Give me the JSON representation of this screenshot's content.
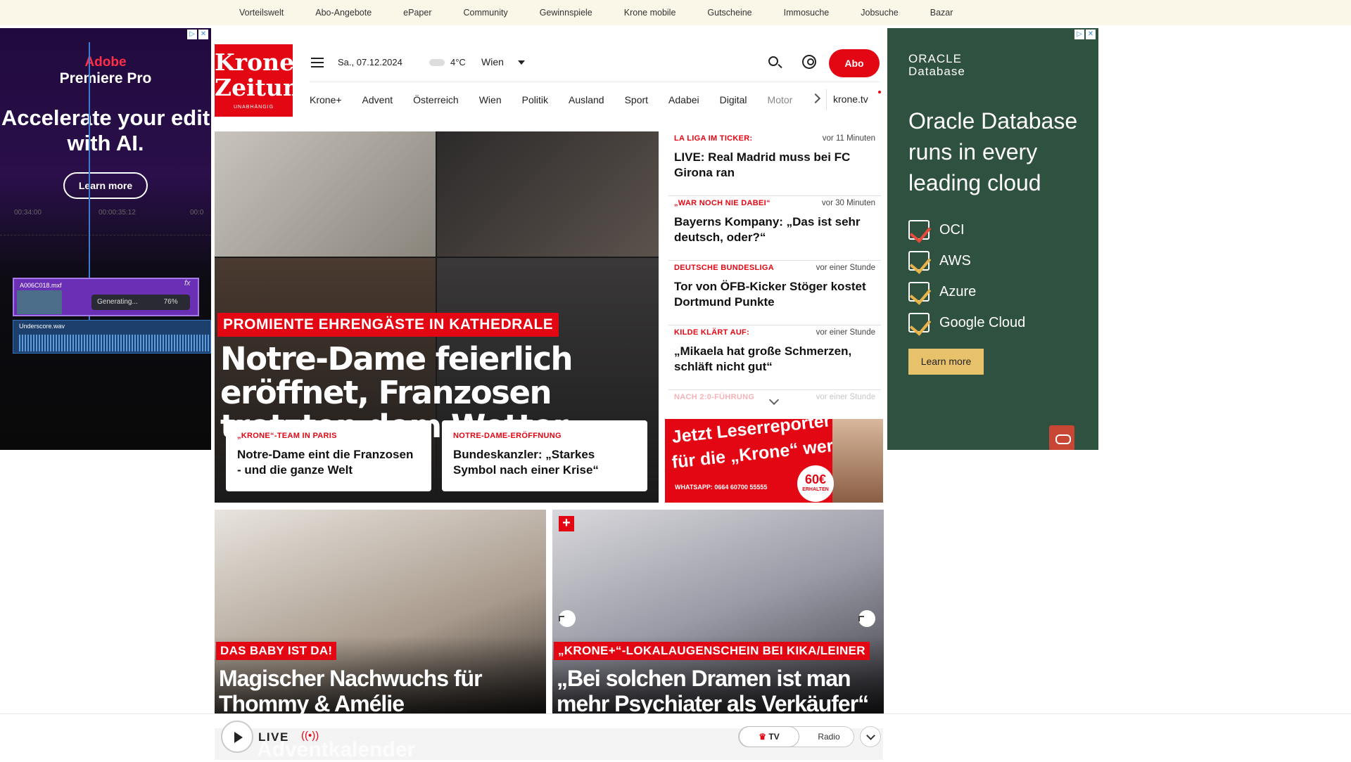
{
  "topnav": [
    "Vorteilswelt",
    "Abo-Angebote",
    "ePaper",
    "Community",
    "Gewinnspiele",
    "Krone mobile",
    "Gutscheine",
    "Immosuche",
    "Jobsuche",
    "Bazar"
  ],
  "logo": {
    "line1": "Kronen",
    "line2": "Zeitung",
    "line3": "UNABHÄNGIG"
  },
  "header": {
    "date": "Sa., 07.12.2024",
    "temperature": "4°C",
    "city": "Wien",
    "abo": "Abo"
  },
  "nav": {
    "items": [
      "Krone+",
      "Advent",
      "Österreich",
      "Wien",
      "Politik",
      "Ausland",
      "Sport",
      "Adabei",
      "Digital",
      "Motor"
    ],
    "tv": "krone.tv"
  },
  "hero": {
    "kicker": "PROMIENTE EHRENGÄSTE IN KATHEDRALE",
    "title": "Notre-Dame feierlich eröffnet, Franzosen trotzten dem Wetter",
    "sub": [
      {
        "kicker": "„KRONE“-TEAM IN PARIS",
        "title": "Notre-Dame eint die Franzosen - und die ganze Welt"
      },
      {
        "kicker": "NOTRE-DAME-ERÖFFNUNG",
        "title": "Bundeskanzler: „Starkes Symbol nach einer Krise“"
      }
    ]
  },
  "ticker": [
    {
      "kicker": "LA LIGA IM TICKER:",
      "time": "vor 11 Minuten",
      "title": "LIVE: Real Madrid muss bei FC Girona ran"
    },
    {
      "kicker": "„WAR NOCH NIE DABEI“",
      "time": "vor 30 Minuten",
      "title": "Bayerns Kompany: „Das ist sehr deutsch, oder?“"
    },
    {
      "kicker": "DEUTSCHE BUNDESLIGA",
      "time": "vor einer Stunde",
      "title": "Tor von ÖFB-Kicker Stöger kostet Dortmund Punkte"
    },
    {
      "kicker": "KILDE KLÄRT AUF:",
      "time": "vor einer Stunde",
      "title": "„Mikaela hat große Schmerzen, schläft nicht gut“"
    },
    {
      "kicker": "NACH 2:0-FÜHRUNG",
      "time": "vor einer Stunde",
      "title": ""
    }
  ],
  "promo": {
    "line1": "Jetzt Leserreporter",
    "line2": "für die „Krone“ werden",
    "whatsapp": "WHATSAPP: 0664 60700 55555",
    "amount": "60€",
    "amount_sub": "ERHALTEN"
  },
  "cards": [
    {
      "kicker": "DAS BABY IST DA!",
      "title": "Magischer Nachwuchs für Thommy & Amélie"
    },
    {
      "kicker": "„KRONE+“-LOKALAUGENSCHEIN BEI KIKA/LEINER",
      "title": "„Bei solchen Dramen ist man mehr Psychiater als Verkäufer“",
      "plus": "+"
    }
  ],
  "ad_left": {
    "brand": "Adobe",
    "product": "Premiere Pro",
    "headline": "Accelerate your edit with AI.",
    "cta": "Learn more",
    "ruler": [
      "00:34:00",
      "00:00:35:12",
      "00:0"
    ],
    "clip_video": "A006C018.mxf",
    "generating": "Generating...",
    "percent": "76%",
    "clip_audio": "Underscore.wav",
    "fx": "fx"
  },
  "ad_right": {
    "logo1": "ORACLE",
    "logo2": "Database",
    "headline": "Oracle Database runs in every leading cloud",
    "list": [
      "OCI",
      "AWS",
      "Azure",
      "Google Cloud"
    ],
    "cta": "Learn more"
  },
  "livebar": {
    "live": "LIVE",
    "bg_text": "Adventkalender",
    "tv": "TV",
    "radio": "Radio"
  }
}
